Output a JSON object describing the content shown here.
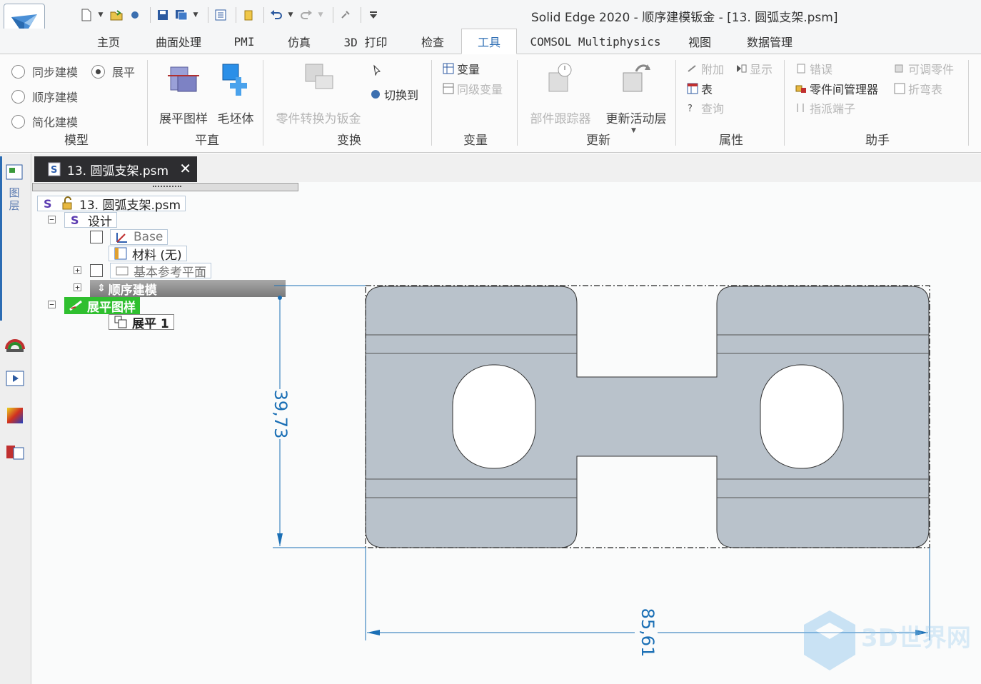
{
  "app": {
    "title": "Solid Edge 2020 - 顺序建模钣金 - [13. 圆弧支架.psm]"
  },
  "quick_access": {
    "icons": [
      "new-icon",
      "open-icon",
      "snapshot-icon",
      "save-icon",
      "save-all-icon",
      "properties-icon",
      "folder-icon",
      "undo-icon",
      "redo-icon",
      "misc-icon",
      "customize-icon"
    ]
  },
  "tabs": [
    {
      "label": "主页"
    },
    {
      "label": "曲面处理"
    },
    {
      "label": "PMI"
    },
    {
      "label": "仿真"
    },
    {
      "label": "3D 打印"
    },
    {
      "label": "检查"
    },
    {
      "label": "工具"
    },
    {
      "label": "COMSOL Multiphysics"
    },
    {
      "label": "视图"
    },
    {
      "label": "数据管理"
    }
  ],
  "active_tab": "工具",
  "ribbon": {
    "model": {
      "label": "模型",
      "sync": "同步建模",
      "flat": "展平",
      "ordered": "顺序建模",
      "simplified": "简化建模"
    },
    "flat": {
      "label": "平直",
      "flat_pattern": "展平图样",
      "blank": "毛坯体"
    },
    "transform": {
      "label": "变换",
      "convert": "零件转换为钣金",
      "switch_to": "切换到"
    },
    "variables": {
      "label": "变量",
      "variables": "变量",
      "peer_variables": "同级变量"
    },
    "update": {
      "label": "更新",
      "part_tracker": "部件跟踪器",
      "update_active": "更新活动层"
    },
    "properties": {
      "label": "属性",
      "attach": "附加",
      "show": "显示",
      "table": "表",
      "query": "查询"
    },
    "assistant": {
      "label": "助手",
      "errors": "错误",
      "adjustable_part": "可调零件",
      "inter_part_manager": "零件间管理器",
      "bend_table": "折弯表",
      "assign_ends": "指派端子"
    }
  },
  "left_strip": {
    "layers_label": "图层"
  },
  "document": {
    "tab_label": "13. 圆弧支架.psm",
    "close_symbol": "✕"
  },
  "tree": {
    "root": "13. 圆弧支架.psm",
    "design": "设计",
    "base": "Base",
    "material": "材料 (无)",
    "ref_planes": "基本参考平面",
    "ordered": "顺序建模",
    "flat_pattern": "展平图样",
    "flat1": "展平 1"
  },
  "drawing": {
    "dim_height": "39,73",
    "dim_width": "85,61",
    "part_fill": "#b9c2cb",
    "dim_color": "#1a6fb5"
  },
  "watermark": {
    "text": "3D世界网"
  }
}
